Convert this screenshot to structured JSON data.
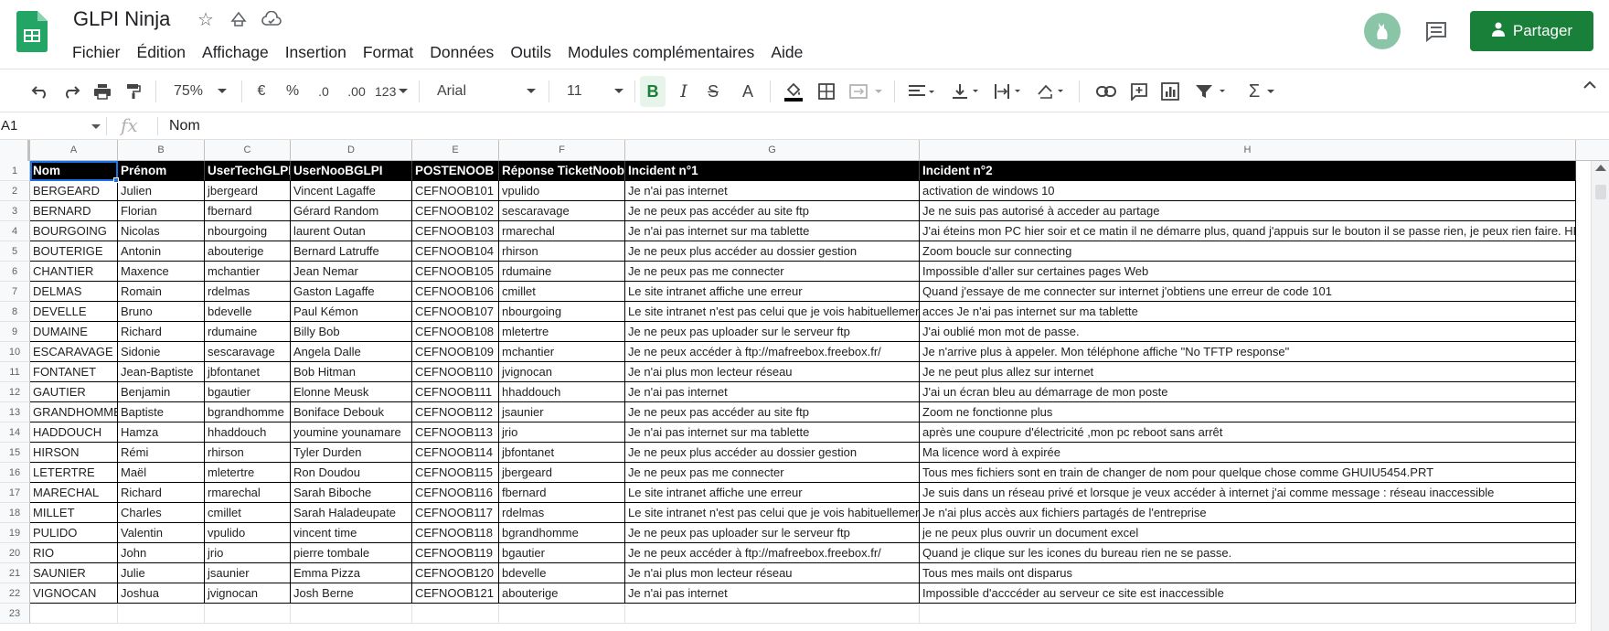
{
  "app": {
    "title": "GLPI Ninja",
    "share_label": "Partager",
    "accent_color": "#188038"
  },
  "menu": [
    "Fichier",
    "Édition",
    "Affichage",
    "Insertion",
    "Format",
    "Données",
    "Outils",
    "Modules complémentaires",
    "Aide"
  ],
  "toolbar": {
    "zoom": "75%",
    "currency": "€",
    "percent": "%",
    "dec_less": ".0",
    "dec_more": ".00",
    "more_formats": "123",
    "font": "Arial",
    "font_size": "11",
    "bold": "B",
    "italic": "I",
    "strike": "S",
    "text_color": "A",
    "functions": "Σ",
    "icons": [
      "undo-icon",
      "redo-icon",
      "print-icon",
      "paint-format-icon",
      "borders-icon",
      "merge-icon",
      "align-left-icon",
      "valign-bottom-icon",
      "text-wrap-icon",
      "text-rotate-icon",
      "link-icon",
      "comment-add-icon",
      "chart-icon",
      "filter-icon"
    ]
  },
  "formula_bar": {
    "cell_ref": "A1",
    "fx": "fx",
    "value": "Nom"
  },
  "columns": [
    "A",
    "B",
    "C",
    "D",
    "E",
    "F",
    "G",
    "H"
  ],
  "rows": [
    "1",
    "2",
    "3",
    "4",
    "5",
    "6",
    "7",
    "8",
    "9",
    "10",
    "11",
    "12",
    "13",
    "14",
    "15",
    "16",
    "17",
    "18",
    "19",
    "20",
    "21",
    "22",
    "23"
  ],
  "sheet": {
    "header": [
      "Nom",
      "Prénom",
      "UserTechGLPI",
      "UserNooBGLPI",
      "POSTENOOB",
      "Réponse TicketNoob",
      "Incident n°1",
      "Incident n°2"
    ],
    "data": [
      [
        "BERGEARD",
        "Julien",
        "jbergeard",
        "Vincent Lagaffe",
        "CEFNOOB101",
        "vpulido",
        "Je n'ai pas internet",
        "activation de windows 10"
      ],
      [
        "BERNARD",
        "Florian",
        "fbernard",
        "Gérard Random",
        "CEFNOOB102",
        "sescaravage",
        "Je ne peux pas accéder au site ftp",
        "Je ne suis pas autorisé à acceder au partage"
      ],
      [
        "BOURGOING",
        "Nicolas",
        "nbourgoing",
        "laurent Outan",
        "CEFNOOB103",
        "rmarechal",
        "Je n'ai pas internet sur ma tablette",
        "J'ai éteins mon PC hier soir et ce matin il ne démarre plus, quand j'appuis sur le bouton il se passe rien, je peux rien faire. HELP!!"
      ],
      [
        "BOUTERIGE",
        "Antonin",
        "abouterige",
        "Bernard Latruffe",
        "CEFNOOB104",
        "rhirson",
        "Je ne peux plus accéder au dossier gestion",
        "Zoom boucle sur connecting"
      ],
      [
        "CHANTIER",
        "Maxence",
        "mchantier",
        "Jean Nemar",
        "CEFNOOB105",
        "rdumaine",
        "Je ne peux pas me connecter",
        "Impossible d'aller sur certaines pages Web"
      ],
      [
        "DELMAS",
        "Romain",
        "rdelmas",
        "Gaston Lagaffe",
        "CEFNOOB106",
        "cmillet",
        "Le site intranet affiche une erreur",
        "Quand j'essaye de me connecter sur internet j'obtiens une erreur de code 101"
      ],
      [
        "DEVELLE",
        "Bruno",
        "bdevelle",
        "Paul Kémon",
        "CEFNOOB107",
        "nbourgoing",
        "Le site intranet n'est pas celui que je vois habituellement",
        "acces Je n'ai pas internet sur ma tablette"
      ],
      [
        "DUMAINE",
        "Richard",
        "rdumaine",
        "Billy Bob",
        "CEFNOOB108",
        "mletertre",
        "Je ne peux pas uploader sur le serveur ftp",
        "J'ai oublié mon mot de passe."
      ],
      [
        "ESCARAVAGE",
        "Sidonie",
        "sescaravage",
        "Angela Dalle",
        "CEFNOOB109",
        "mchantier",
        "Je ne peux accéder à ftp://mafreebox.freebox.fr/",
        "Je n'arrive plus à appeler. Mon téléphone affiche \"No TFTP response\""
      ],
      [
        "FONTANET",
        "Jean-Baptiste",
        "jbfontanet",
        "Bob Hitman",
        "CEFNOOB110",
        "jvignocan",
        "Je n'ai plus mon lecteur réseau",
        "Je ne peut plus allez sur internet"
      ],
      [
        "GAUTIER",
        "Benjamin",
        "bgautier",
        "Elonne Meusk",
        "CEFNOOB111",
        "hhaddouch",
        "Je n'ai pas internet",
        "J'ai un écran bleu au démarrage de mon poste"
      ],
      [
        "GRANDHOMME",
        "Baptiste",
        "bgrandhomme",
        "Boniface Debouk",
        "CEFNOOB112",
        "jsaunier",
        "Je ne peux pas accéder au site ftp",
        "Zoom ne fonctionne plus"
      ],
      [
        "HADDOUCH",
        "Hamza",
        "hhaddouch",
        "youmine younamare",
        "CEFNOOB113",
        "jrio",
        "Je n'ai pas internet sur ma tablette",
        "après une coupure d'électricité ,mon pc reboot sans arrêt"
      ],
      [
        "HIRSON",
        "Rémi",
        "rhirson",
        "Tyler Durden",
        "CEFNOOB114",
        "jbfontanet",
        "Je ne peux plus accéder au dossier gestion",
        "Ma licence word à expirée"
      ],
      [
        "LETERTRE",
        "Maël",
        "mletertre",
        "Ron Doudou",
        "CEFNOOB115",
        "jbergeard",
        "Je ne peux pas me connecter",
        "Tous mes fichiers sont en train de changer de nom pour quelque chose comme GHUIU5454.PRT"
      ],
      [
        "MARECHAL",
        "Richard",
        "rmarechal",
        "Sarah Biboche",
        "CEFNOOB116",
        "fbernard",
        "Le site intranet affiche une erreur",
        "Je suis dans un réseau privé et lorsque je veux accéder à internet j'ai comme message : réseau inaccessible"
      ],
      [
        "MILLET",
        "Charles",
        "cmillet",
        "Sarah Haladeupate",
        "CEFNOOB117",
        "rdelmas",
        "Le site intranet n'est pas celui que je vois habituellement",
        "Je n'ai plus accès aux fichiers partagés de l'entreprise"
      ],
      [
        "PULIDO",
        "Valentin",
        "vpulido",
        "vincent time",
        "CEFNOOB118",
        "bgrandhomme",
        "Je ne peux pas uploader sur le serveur ftp",
        "je ne peux plus ouvrir un document excel"
      ],
      [
        "RIO",
        "John",
        "jrio",
        "pierre tombale",
        "CEFNOOB119",
        "bgautier",
        "Je ne peux accéder à ftp://mafreebox.freebox.fr/",
        "Quand je clique sur les icones du bureau rien ne se passe."
      ],
      [
        "SAUNIER",
        "Julie",
        "jsaunier",
        "Emma Pizza",
        "CEFNOOB120",
        "bdevelle",
        "Je n'ai plus mon lecteur réseau",
        "Tous mes mails ont disparus"
      ],
      [
        "VIGNOCAN",
        "Joshua",
        "jvignocan",
        "Josh Berne",
        "CEFNOOB121",
        "abouterige",
        "Je n'ai pas internet",
        "Impossible d'acccéder au serveur ce site est inaccessible"
      ]
    ],
    "link_text": "ftp://mafreebox.freebox.fr/",
    "link_prefix": "Je ne peux accéder à "
  }
}
